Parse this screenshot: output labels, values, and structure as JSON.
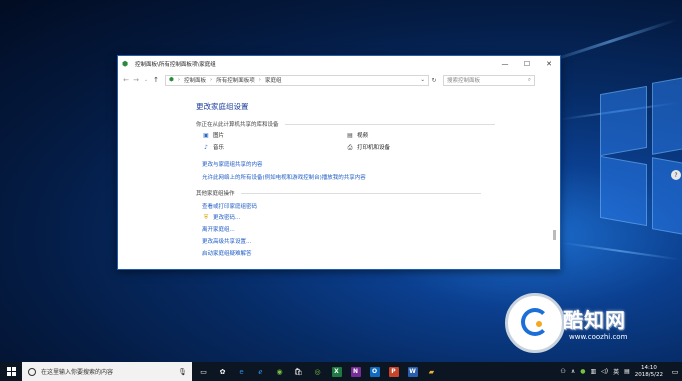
{
  "window": {
    "title": "控制面板\\所有控制面板项\\家庭组",
    "minimize": "—",
    "maximize": "☐",
    "close": "✕"
  },
  "addressbar": {
    "crumbs": [
      "控制面板",
      "所有控制面板项",
      "家庭组"
    ],
    "search_placeholder": "搜索控制面板"
  },
  "main": {
    "heading": "更改家庭组设置",
    "shared_section": "你正在从此计算机共享的库和设备",
    "libs": [
      "图片",
      "视频",
      "音乐",
      "打印机和设备"
    ],
    "links1": [
      "更改与家庭组共享的内容",
      "允许此网络上的所有设备(例如电视和游戏控制台)播放我的共享内容"
    ],
    "other_section": "其他家庭组操作",
    "links2": [
      "查看或打印家庭组密码",
      "更改密码...",
      "离开家庭组...",
      "更改高级共享设置...",
      "启动家庭组疑难解答"
    ]
  },
  "watermark": {
    "title": "酷知网",
    "url": "www.coozhi.com"
  },
  "taskbar": {
    "search_text": "在这里输入你要搜索的内容",
    "apps": [
      "X",
      "N",
      "O",
      "P",
      "W"
    ],
    "ime": "英",
    "time": "14:10",
    "date": "2018/5/22",
    "notif_count": "2"
  },
  "colors": {
    "accent": "#1e5bc6",
    "heading": "#1e3f9e",
    "excel": "#1f7a42",
    "onenote": "#7a2b9a",
    "outlook": "#0f6ac0",
    "powerpoint": "#c8452c",
    "word": "#2a5fb0"
  }
}
